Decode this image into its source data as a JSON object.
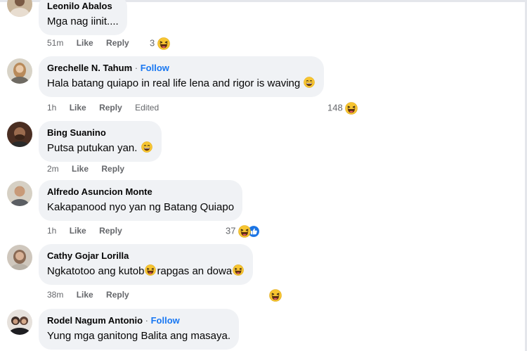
{
  "colors": {
    "bubble": "#f0f2f5",
    "link": "#1877f2",
    "meta": "#65676b",
    "text": "#050505"
  },
  "labels": {
    "like": "Like",
    "reply": "Reply",
    "edited": "Edited",
    "follow": "Follow",
    "dot": "·"
  },
  "comments": [
    {
      "name": "Leonilo Abalos",
      "text": "Mga nag iinit....",
      "time": "51m",
      "reactions": "3",
      "reaction_icon": "haha-emoji"
    },
    {
      "name": "Grechelle N. Tahum",
      "follow": true,
      "text": "Hala batang quiapo in real life lena and rigor is waving",
      "time": "1h",
      "edited": true,
      "reactions": "148",
      "reaction_icon": "haha-emoji"
    },
    {
      "name": "Bing Suanino",
      "text": "Putsa putukan yan.",
      "time": "2m"
    },
    {
      "name": "Alfredo Asuncion Monte",
      "text": "Kakapanood nyo yan ng Batang Quiapo",
      "time": "1h",
      "reactions": "37",
      "reaction_icon": "haha-and-like"
    },
    {
      "name": "Cathy Gojar Lorilla",
      "text_a": "Ngkatotoo ang kutob",
      "text_b": "rapgas an dowa",
      "time": "38m",
      "reaction_icon": "haha-emoji"
    },
    {
      "name": "Rodel Nagum Antonio",
      "follow": true,
      "text": "Yung mga ganitong Balita ang masaya."
    }
  ]
}
